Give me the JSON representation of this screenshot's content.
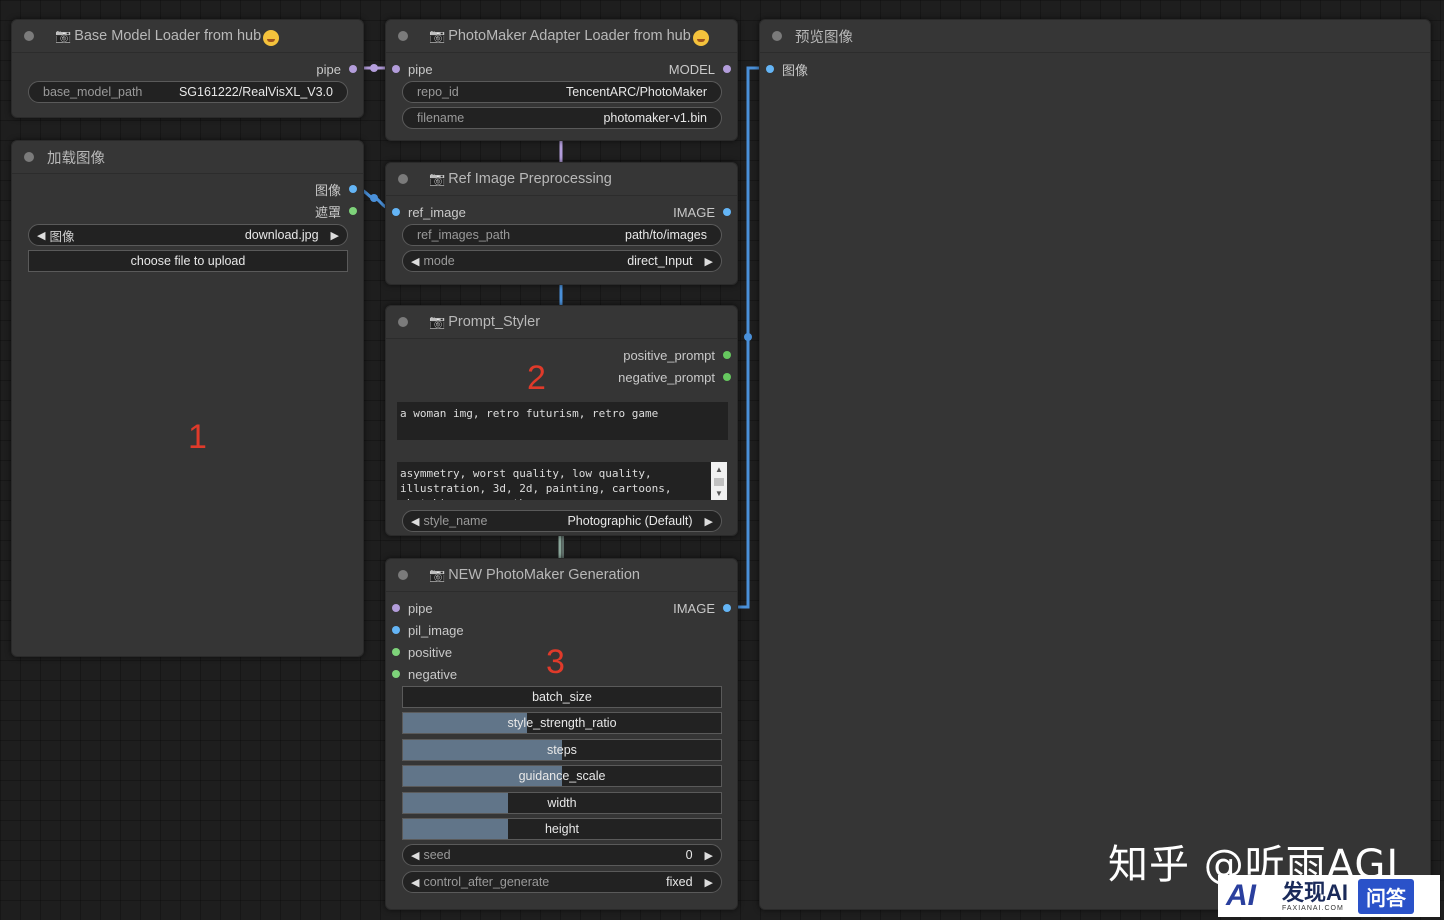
{
  "nodes": {
    "base_model": {
      "title": "Base Model Loader from hub",
      "output_pipe": "pipe",
      "widget_label": "base_model_path",
      "widget_value": "SG161222/RealVisXL_V3.0"
    },
    "load_image": {
      "title": "加载图像",
      "output_image": "图像",
      "output_mask": "遮罩",
      "image_label": "图像",
      "image_value": "download.jpg",
      "upload_label": "choose file to upload"
    },
    "adapter": {
      "title": "PhotoMaker Adapter Loader from hub",
      "input_pipe": "pipe",
      "output_model": "MODEL",
      "repo_label": "repo_id",
      "repo_value": "TencentARC/PhotoMaker",
      "filename_label": "filename",
      "filename_value": "photomaker-v1.bin"
    },
    "preprocess": {
      "title": "Ref Image Preprocessing",
      "input_ref": "ref_image",
      "output_image": "IMAGE",
      "path_label": "ref_images_path",
      "path_value": "path/to/images",
      "mode_label": "mode",
      "mode_value": "direct_Input"
    },
    "styler": {
      "title": "Prompt_Styler",
      "output_positive": "positive_prompt",
      "output_negative": "negative_prompt",
      "positive_text": "a woman img, retro futurism, retro game",
      "negative_text": "asymmetry, worst quality, low quality, illustration, 3d, 2d, painting, cartoons, sketch), open mouth",
      "style_label": "style_name",
      "style_value": "Photographic (Default)"
    },
    "generation": {
      "title": "NEW PhotoMaker Generation",
      "input_pipe": "pipe",
      "input_pil": "pil_image",
      "input_positive": "positive",
      "input_negative": "negative",
      "output_image": "IMAGE",
      "batch_size": "batch_size",
      "style_strength_ratio": "style_strength_ratio",
      "steps": "steps",
      "guidance_scale": "guidance_scale",
      "width": "width",
      "height": "height",
      "seed_label": "seed",
      "seed_value": "0",
      "control_label": "control_after_generate",
      "control_value": "fixed",
      "slider_fill": {
        "batch_size": 0,
        "style_strength_ratio": 0.39,
        "steps": 0.5,
        "guidance_scale": 0.5,
        "width": 0.33,
        "height": 0.33
      }
    },
    "preview": {
      "title": "预览图像",
      "input_image": "图像"
    }
  },
  "annotations": {
    "a1": "1",
    "a2": "2",
    "a3": "3"
  },
  "watermark": "知乎 @听雨AGI",
  "logo": {
    "mark": "AI",
    "main": "发现AI",
    "sub": "FAXIANAI.COM",
    "badge": "问答"
  },
  "colors": {
    "pipe": "#b39ddb",
    "image": "#64b5f6",
    "conditioning": "#7ed37a",
    "annotation": "#e03a2a"
  },
  "icons": {
    "title_icon": "camera-icon"
  }
}
